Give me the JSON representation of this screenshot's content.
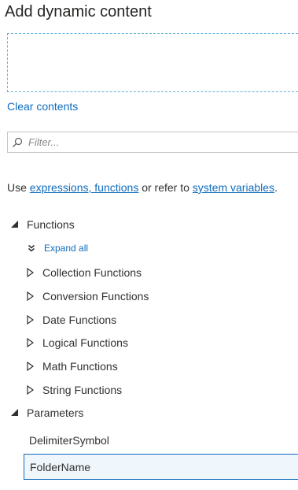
{
  "title": "Add dynamic content",
  "clear_contents": "Clear contents",
  "filter": {
    "placeholder": "Filter...",
    "value": ""
  },
  "help": {
    "prefix": "Use ",
    "link1": "expressions, functions",
    "middle": " or refer to ",
    "link2": "system variables",
    "suffix": "."
  },
  "functions": {
    "label": "Functions",
    "expand_all": "Expand all",
    "items": [
      "Collection Functions",
      "Conversion Functions",
      "Date Functions",
      "Logical Functions",
      "Math Functions",
      "String Functions"
    ]
  },
  "parameters": {
    "label": "Parameters",
    "items": [
      "DelimiterSymbol",
      "FolderName"
    ],
    "selected": "FolderName"
  },
  "colors": {
    "link": "#0f6cbd",
    "selected_bg": "#eff6fc",
    "dashed_border": "#5fb3d9"
  }
}
